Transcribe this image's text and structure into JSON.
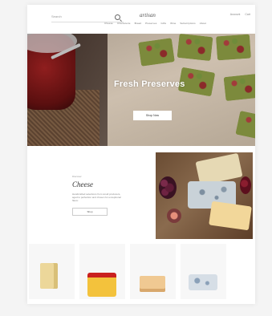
{
  "header": {
    "search_label": "Search",
    "logo_text": "artisan",
    "account_links": [
      "Account",
      "Cart"
    ],
    "nav_items": [
      "Cheese",
      "Charcuterie",
      "Bread",
      "Preserves",
      "Gifts",
      "Wine",
      "Subscriptions",
      "About"
    ]
  },
  "hero": {
    "title": "Fresh Preserves",
    "button_label": "Shop Now"
  },
  "feature": {
    "kicker": "Discover",
    "title": "Cheese",
    "description": "Handcrafted selections from small producers, aged to perfection and chosen for exceptional flavor.",
    "button_label": "Shop"
  },
  "products": [
    {
      "icon": "aged-cheese-wedge-icon"
    },
    {
      "icon": "red-wax-cheese-icon"
    },
    {
      "icon": "soft-cheese-slice-icon"
    },
    {
      "icon": "blue-cheese-icon"
    }
  ],
  "colors": {
    "page_background": "#f4f4f4",
    "card_background": "#ffffff",
    "hero_text": "#ffffff"
  }
}
